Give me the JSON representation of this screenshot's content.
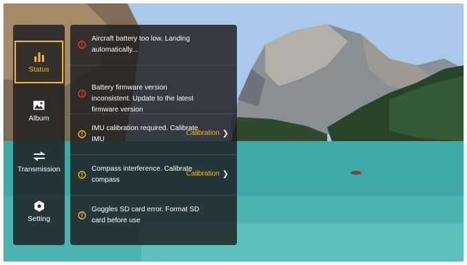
{
  "nav": {
    "items": [
      {
        "label": "Status",
        "icon": "bar-chart-icon"
      },
      {
        "label": "Album",
        "icon": "image-icon"
      },
      {
        "label": "Transmission",
        "icon": "swap-arrows-icon"
      },
      {
        "label": "Setting",
        "icon": "hexagon-gear-icon"
      }
    ],
    "active": "Status"
  },
  "messages": [
    {
      "text": "Aircraft battery too low. Landing automatically...",
      "severity": "error",
      "color": "#e53935"
    },
    {
      "text": "Battery firmware version inconsistent. Update to the latest firmware version",
      "severity": "error",
      "color": "#e53935"
    },
    {
      "text": "IMU calibration required. Calibrate IMU",
      "severity": "warning",
      "color": "#f6b91f",
      "action": "Calibration"
    },
    {
      "text": "Compass interference. Calibrate compass",
      "severity": "warning",
      "color": "#f6b91f",
      "action": "Calibration"
    },
    {
      "text": "Goggles SD card error. Format SD card before use",
      "severity": "warning",
      "color": "#f6b91f"
    }
  ],
  "colors": {
    "accent": "#f6b91f",
    "error": "#e53935"
  }
}
